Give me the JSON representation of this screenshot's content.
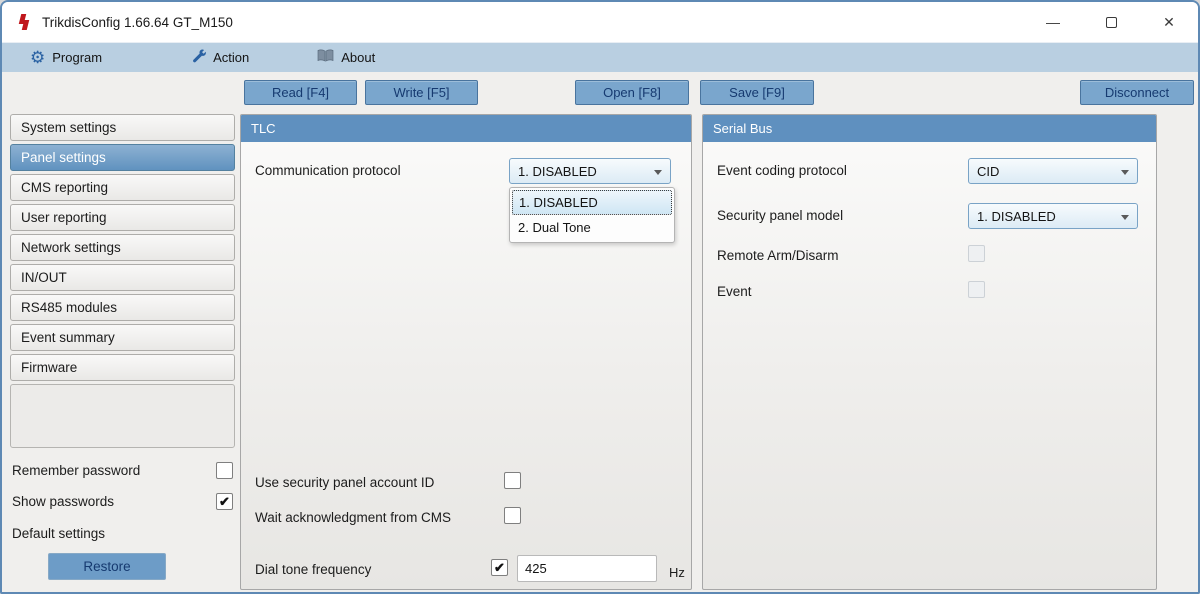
{
  "window": {
    "title": "TrikdisConfig 1.66.64  GT_M150"
  },
  "icons": {
    "check": "✔",
    "minimize": "—",
    "close": "✕",
    "gear": "⚙"
  },
  "menu": {
    "items": [
      {
        "label": "Program",
        "icon": "gear-icon"
      },
      {
        "label": "Action",
        "icon": "wrench-icon"
      },
      {
        "label": "About",
        "icon": "book-icon"
      }
    ]
  },
  "toolbar": {
    "read": "Read [F4]",
    "write": "Write [F5]",
    "open": "Open [F8]",
    "save": "Save [F9]",
    "disconnect": "Disconnect"
  },
  "sidebar": {
    "items": [
      {
        "label": "System settings",
        "selected": false
      },
      {
        "label": "Panel settings",
        "selected": true
      },
      {
        "label": "CMS reporting",
        "selected": false
      },
      {
        "label": "User reporting",
        "selected": false
      },
      {
        "label": "Network settings",
        "selected": false
      },
      {
        "label": "IN/OUT",
        "selected": false
      },
      {
        "label": "RS485 modules",
        "selected": false
      },
      {
        "label": "Event summary",
        "selected": false
      },
      {
        "label": "Firmware",
        "selected": false
      }
    ],
    "remember_password": {
      "label": "Remember password",
      "checked": false
    },
    "show_passwords": {
      "label": "Show passwords",
      "checked": true
    },
    "default_settings_label": "Default settings",
    "restore_label": "Restore"
  },
  "tlc_panel": {
    "title": "TLC",
    "communication_protocol": {
      "label": "Communication protocol",
      "value": "1. DISABLED",
      "options": [
        "1. DISABLED",
        "2. Dual Tone"
      ],
      "focused_option": "1. DISABLED"
    },
    "use_account_id": {
      "label": "Use security panel account ID",
      "checked": false
    },
    "wait_ack": {
      "label": "Wait acknowledgment from CMS",
      "checked": false
    },
    "dial_tone": {
      "label": "Dial tone frequency",
      "checked": true,
      "value": "425",
      "unit": "Hz"
    }
  },
  "serial_bus_panel": {
    "title": "Serial Bus",
    "event_coding_protocol": {
      "label": "Event coding protocol",
      "value": "CID"
    },
    "security_panel_model": {
      "label": "Security panel model",
      "value": "1. DISABLED"
    },
    "remote_arm_disarm": {
      "label": "Remote Arm/Disarm",
      "checked": false,
      "disabled": true
    },
    "event": {
      "label": "Event",
      "checked": false,
      "disabled": true
    }
  },
  "colors": {
    "accent_blue": "#5f90bf",
    "menubar_blue": "#b9cfe1",
    "button_blue": "#7aa6cd",
    "button_text_navy": "#163a70",
    "selected_nav": "#6092bf",
    "logo_red": "#c0171c"
  }
}
